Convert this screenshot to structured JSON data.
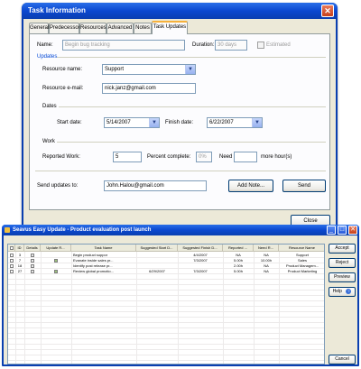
{
  "dialog1": {
    "title": "Task Information",
    "close_glyph": "✕",
    "tabs": [
      "General",
      "Predecessors",
      "Resources",
      "Advanced",
      "Notes",
      "Task Updates"
    ],
    "name_label": "Name:",
    "name_value": "Begin bug tracking",
    "duration_label": "Duration:",
    "duration_value": "30 days",
    "estimated_label": "Estimated",
    "updates_section": "Updates",
    "resource_name_label": "Resource name:",
    "resource_name_value": "Support",
    "resource_email_label": "Resource e-mail:",
    "resource_email_value": "nick.janz@gmail.com",
    "dates_section": "Dates",
    "start_date_label": "Start date:",
    "start_date_value": "5/14/2007",
    "finish_date_label": "Finish date:",
    "finish_date_value": "6/22/2007",
    "work_section": "Work",
    "reported_work_label": "Reported Work:",
    "reported_work_value": "5",
    "percent_complete_label": "Percent complete:",
    "percent_complete_value": "0%",
    "need_label": "Need",
    "need_value": "",
    "more_hours_label": "more hour(s)",
    "send_updates_label": "Send updates to:",
    "send_updates_value": "John.Halou@gmail.com",
    "add_note_button": "Add Note...",
    "send_button": "Send",
    "close_button": "Close"
  },
  "dialog2": {
    "title": "Seavus Easy Update - Product evaluation post launch",
    "columns": [
      "ID",
      "Details",
      "Update R...",
      "Task Name",
      "Suggested Start D...",
      "Suggested Finish D...",
      "Reported ...",
      "Need R...",
      "Resource Name"
    ],
    "rows": [
      {
        "id": "3",
        "details": true,
        "update": false,
        "task": "Begin product suppor",
        "start": "",
        "finish": "4/4/2007",
        "reported": "NA",
        "need": "NA",
        "resource": "Support"
      },
      {
        "id": "7",
        "details": true,
        "update": true,
        "task": "Evanate inside sales pr...",
        "start": "",
        "finish": "7/3/2007",
        "reported": "5.00h",
        "need": "10.00h",
        "resource": "Sales"
      },
      {
        "id": "18",
        "details": true,
        "update": false,
        "task": "Identify post release pr...",
        "start": "",
        "finish": "",
        "reported": "2.00h",
        "need": "NA",
        "resource": "Product Managem..."
      },
      {
        "id": "27",
        "details": true,
        "update": true,
        "task": "Review global promotio...",
        "start": "6/29/2007",
        "finish": "7/3/2007",
        "reported": "5.00h",
        "need": "NA",
        "resource": "Product Marketing"
      }
    ],
    "buttons": {
      "accept": "Accept",
      "reject": "Reject",
      "preview": "Preview",
      "help": "Help",
      "cancel": "Cancel"
    },
    "window_buttons": {
      "minimize": "_",
      "maximize": "□",
      "close": "✕"
    }
  }
}
